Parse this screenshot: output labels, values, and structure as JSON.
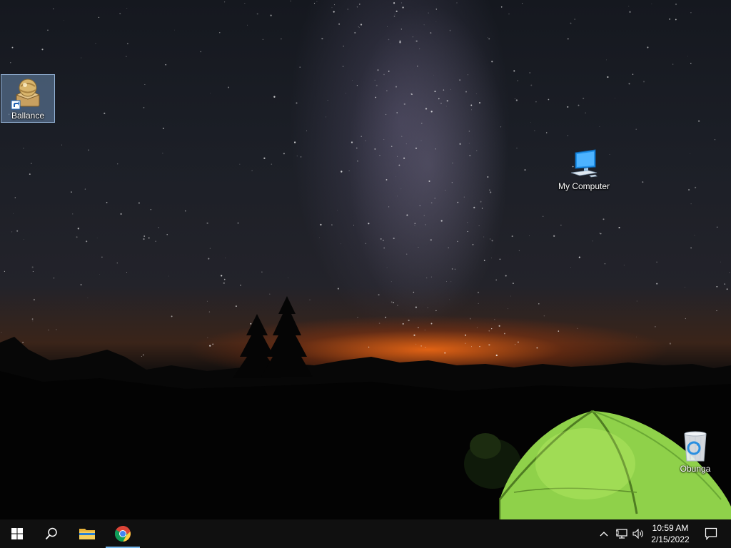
{
  "desktop": {
    "wallpaper": "night-sky-milky-way-tent",
    "icons": [
      {
        "label": "Ballance",
        "icon": "ballance-app-icon",
        "selected": true
      },
      {
        "label": "My Computer",
        "icon": "computer-icon",
        "selected": false
      },
      {
        "label": "Obunga",
        "icon": "recycle-bin-icon",
        "selected": false
      }
    ]
  },
  "taskbar": {
    "start": "windows-start-icon",
    "search": "search-icon",
    "pinned": [
      {
        "name": "File Explorer",
        "icon": "folder-icon",
        "active": false
      },
      {
        "name": "Google Chrome",
        "icon": "chrome-icon",
        "active": true
      }
    ],
    "tray": {
      "chevron": "chevron-up-icon",
      "network": "network-icon",
      "volume": "volume-icon"
    },
    "clock": {
      "time": "10:59 AM",
      "date": "2/15/2022"
    },
    "notifications": "notification-icon"
  },
  "colors": {
    "taskbar": "#101010",
    "active_indicator": "#76b9ed",
    "tent": "#8fd14a",
    "selection": "#99c9ff"
  }
}
